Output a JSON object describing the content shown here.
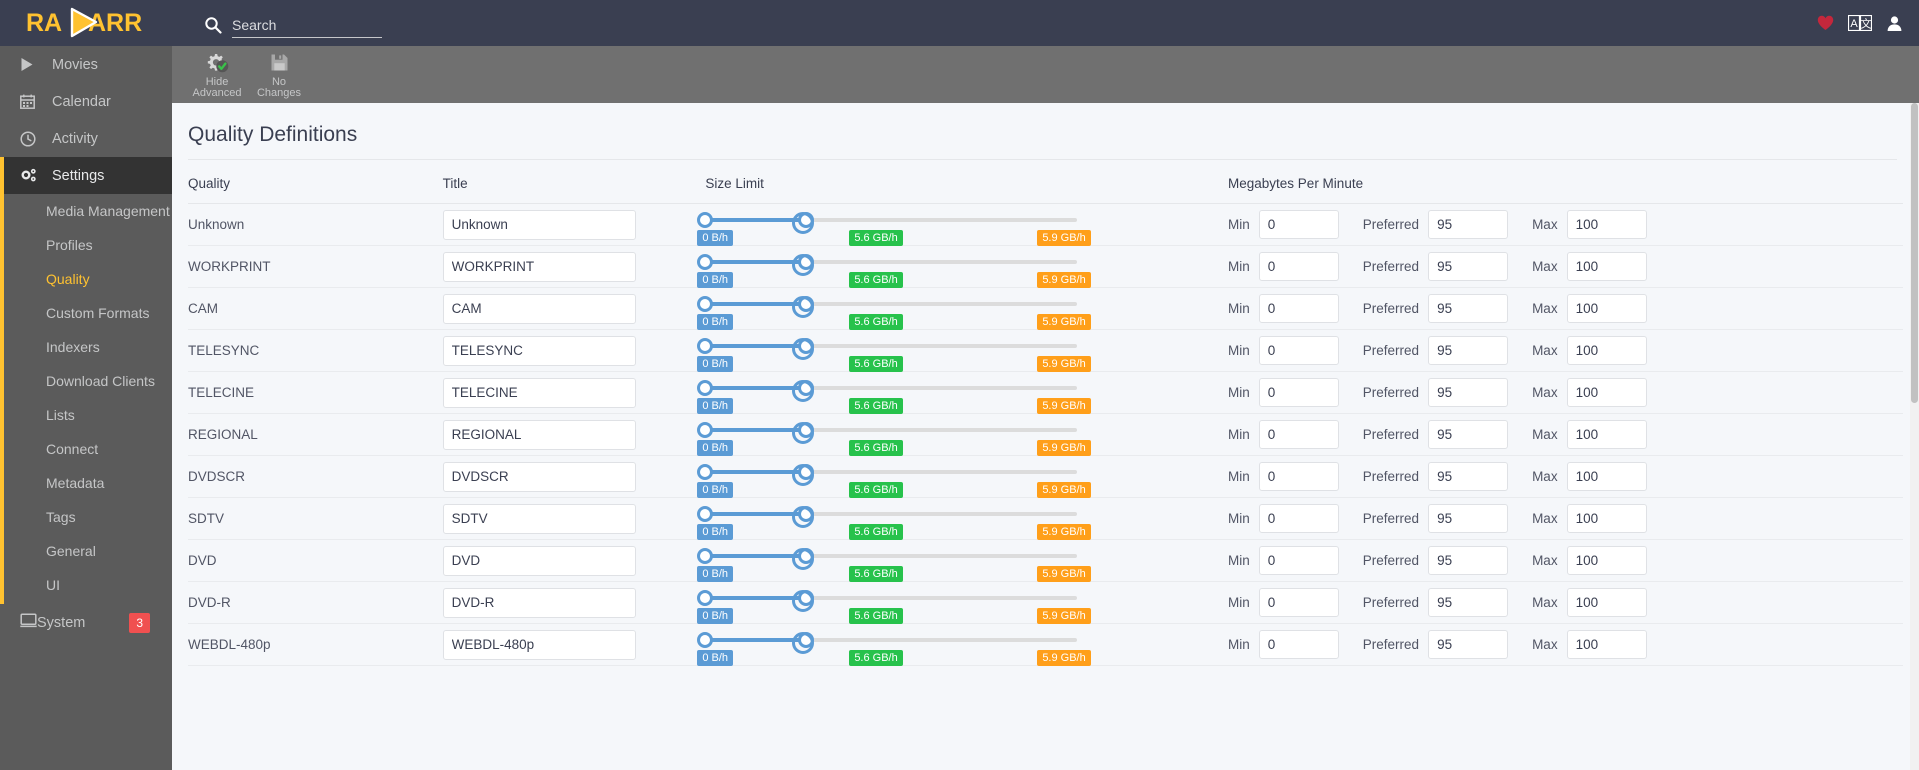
{
  "header": {
    "brand": "RADARR",
    "search": {
      "placeholder": "Search",
      "value": ""
    },
    "icons": {
      "donate": "heart-icon",
      "translate": "translate-icon",
      "account": "user-icon"
    }
  },
  "sidebar": {
    "items": [
      {
        "label": "Movies",
        "icon": "play-icon",
        "active": false
      },
      {
        "label": "Calendar",
        "icon": "calendar-icon",
        "active": false
      },
      {
        "label": "Activity",
        "icon": "clock-icon",
        "active": false
      },
      {
        "label": "Settings",
        "icon": "gears-icon",
        "active": true
      }
    ],
    "settings_subitems": [
      {
        "label": "Media Management",
        "selected": false
      },
      {
        "label": "Profiles",
        "selected": false
      },
      {
        "label": "Quality",
        "selected": true
      },
      {
        "label": "Custom Formats",
        "selected": false
      },
      {
        "label": "Indexers",
        "selected": false
      },
      {
        "label": "Download Clients",
        "selected": false
      },
      {
        "label": "Lists",
        "selected": false
      },
      {
        "label": "Connect",
        "selected": false
      },
      {
        "label": "Metadata",
        "selected": false
      },
      {
        "label": "Tags",
        "selected": false
      },
      {
        "label": "General",
        "selected": false
      },
      {
        "label": "UI",
        "selected": false
      }
    ],
    "system": {
      "label": "System",
      "icon": "desktop-icon",
      "badge": "3"
    }
  },
  "toolbar": {
    "buttons": [
      {
        "label_line1": "Hide",
        "label_line2": "Advanced",
        "icon": "advanced-settings-icon"
      },
      {
        "label_line1": "No",
        "label_line2": "Changes",
        "icon": "save-icon"
      }
    ]
  },
  "main": {
    "title": "Quality Definitions",
    "columns": {
      "quality": "Quality",
      "title": "Title",
      "size_limit": "Size Limit",
      "megabytes_per_minute": "Megabytes Per Minute"
    },
    "mb_labels": {
      "min": "Min",
      "preferred": "Preferred",
      "max": "Max"
    },
    "slider_badges": {
      "min": "0 B/h",
      "preferred": "5.6 GB/h",
      "max": "5.9 GB/h"
    },
    "rows": [
      {
        "quality": "Unknown",
        "title": "Unknown",
        "min": "0",
        "preferred": "95",
        "max": "100",
        "size_min": "0 B/h",
        "size_pref": "5.6 GB/h",
        "size_max": "5.9 GB/h"
      },
      {
        "quality": "WORKPRINT",
        "title": "WORKPRINT",
        "min": "0",
        "preferred": "95",
        "max": "100",
        "size_min": "0 B/h",
        "size_pref": "5.6 GB/h",
        "size_max": "5.9 GB/h"
      },
      {
        "quality": "CAM",
        "title": "CAM",
        "min": "0",
        "preferred": "95",
        "max": "100",
        "size_min": "0 B/h",
        "size_pref": "5.6 GB/h",
        "size_max": "5.9 GB/h"
      },
      {
        "quality": "TELESYNC",
        "title": "TELESYNC",
        "min": "0",
        "preferred": "95",
        "max": "100",
        "size_min": "0 B/h",
        "size_pref": "5.6 GB/h",
        "size_max": "5.9 GB/h"
      },
      {
        "quality": "TELECINE",
        "title": "TELECINE",
        "min": "0",
        "preferred": "95",
        "max": "100",
        "size_min": "0 B/h",
        "size_pref": "5.6 GB/h",
        "size_max": "5.9 GB/h"
      },
      {
        "quality": "REGIONAL",
        "title": "REGIONAL",
        "min": "0",
        "preferred": "95",
        "max": "100",
        "size_min": "0 B/h",
        "size_pref": "5.6 GB/h",
        "size_max": "5.9 GB/h"
      },
      {
        "quality": "DVDSCR",
        "title": "DVDSCR",
        "min": "0",
        "preferred": "95",
        "max": "100",
        "size_min": "0 B/h",
        "size_pref": "5.6 GB/h",
        "size_max": "5.9 GB/h"
      },
      {
        "quality": "SDTV",
        "title": "SDTV",
        "min": "0",
        "preferred": "95",
        "max": "100",
        "size_min": "0 B/h",
        "size_pref": "5.6 GB/h",
        "size_max": "5.9 GB/h"
      },
      {
        "quality": "DVD",
        "title": "DVD",
        "min": "0",
        "preferred": "95",
        "max": "100",
        "size_min": "0 B/h",
        "size_pref": "5.6 GB/h",
        "size_max": "5.9 GB/h"
      },
      {
        "quality": "DVD-R",
        "title": "DVD-R",
        "min": "0",
        "preferred": "95",
        "max": "100",
        "size_min": "0 B/h",
        "size_pref": "5.6 GB/h",
        "size_max": "5.9 GB/h"
      },
      {
        "quality": "WEBDL-480p",
        "title": "WEBDL-480p",
        "min": "0",
        "preferred": "95",
        "max": "100",
        "size_min": "0 B/h",
        "size_pref": "5.6 GB/h",
        "size_max": "5.9 GB/h"
      }
    ]
  },
  "colors": {
    "brand_yellow": "#ffc230",
    "header_bg": "#3a3f51",
    "sidebar_bg": "#5b5b5b",
    "toolbar_bg": "#707070",
    "slider_blue": "#5b9bd5",
    "badge_green": "#27c24c",
    "badge_orange": "#ff9f1a",
    "badge_red": "#f05050",
    "heart_red": "#c4273c"
  }
}
